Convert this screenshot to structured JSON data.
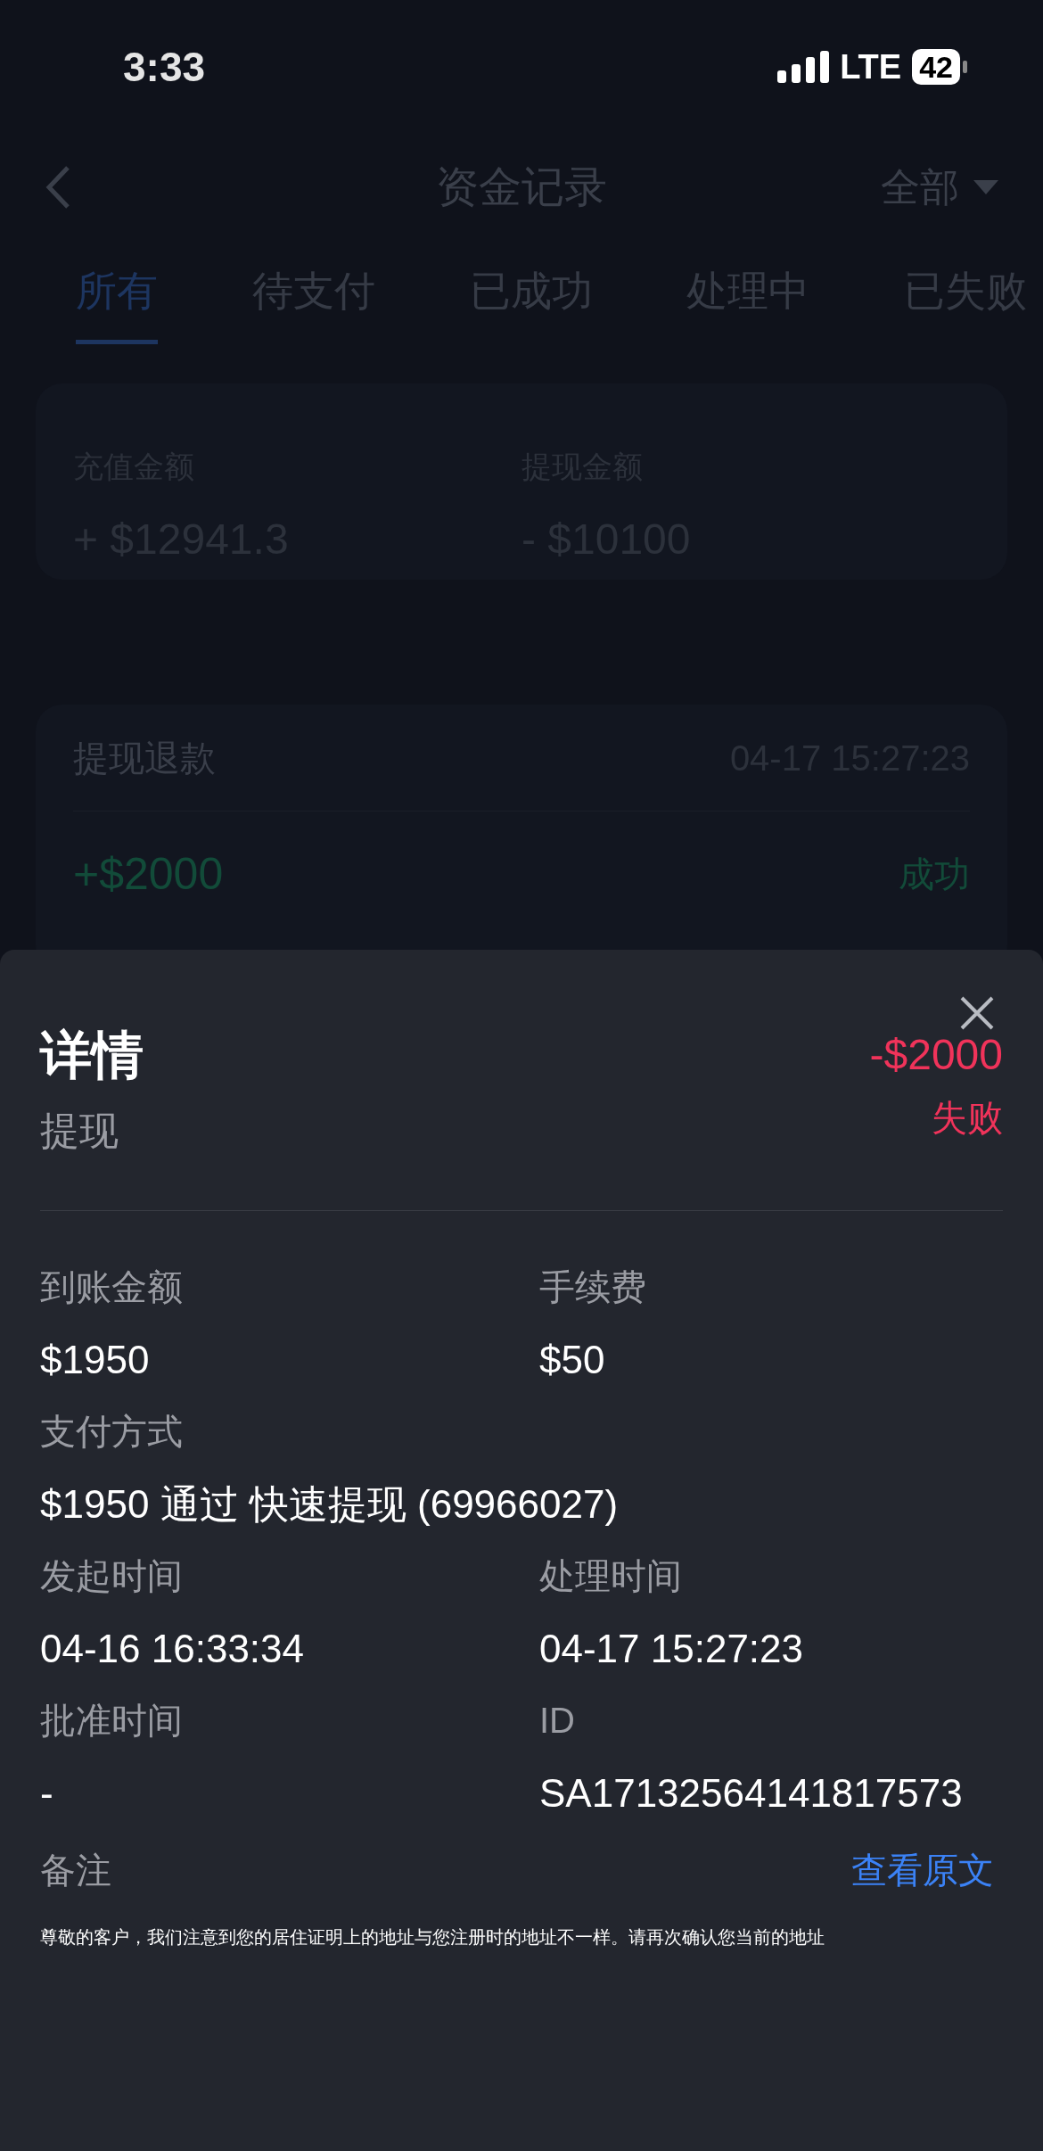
{
  "status_bar": {
    "time": "3:33",
    "network": "LTE",
    "battery": "42"
  },
  "nav": {
    "title": "资金记录",
    "filter": "全部"
  },
  "tabs": [
    {
      "label": "所有",
      "selected": true
    },
    {
      "label": "待支付",
      "selected": false
    },
    {
      "label": "已成功",
      "selected": false
    },
    {
      "label": "处理中",
      "selected": false
    },
    {
      "label": "已失败",
      "selected": false
    }
  ],
  "summary": [
    {
      "label": "充值金额",
      "value": "+ $12941.3"
    },
    {
      "label": "提现金额",
      "value": "- $10100"
    }
  ],
  "record": {
    "title": "提现退款",
    "time": "04-17 15:27:23",
    "amount": "+$2000",
    "status": "成功"
  },
  "detail": {
    "title": "详情",
    "subtitle": "提现",
    "amount": "-$2000",
    "status": "失败",
    "fields": [
      {
        "kind": "half",
        "label": "到账金额",
        "value": "$1950"
      },
      {
        "kind": "half",
        "label": "手续费",
        "value": "$50"
      },
      {
        "kind": "full",
        "label": "支付方式",
        "value": "$1950 通过 快速提现 (69966027)"
      },
      {
        "kind": "half",
        "label": "发起时间",
        "value": "04-16 16:33:34"
      },
      {
        "kind": "half",
        "label": "处理时间",
        "value": "04-17 15:27:23"
      },
      {
        "kind": "half",
        "label": "批准时间",
        "value": "-"
      },
      {
        "kind": "half",
        "label": "ID",
        "value": "SA17132564141817573"
      }
    ],
    "remark": {
      "label": "备注",
      "link": "查看原文",
      "text": "尊敬的客户，我们注意到您的居住证明上的地址与您注册时的地址不一样。请再次确认您当前的地址"
    }
  }
}
